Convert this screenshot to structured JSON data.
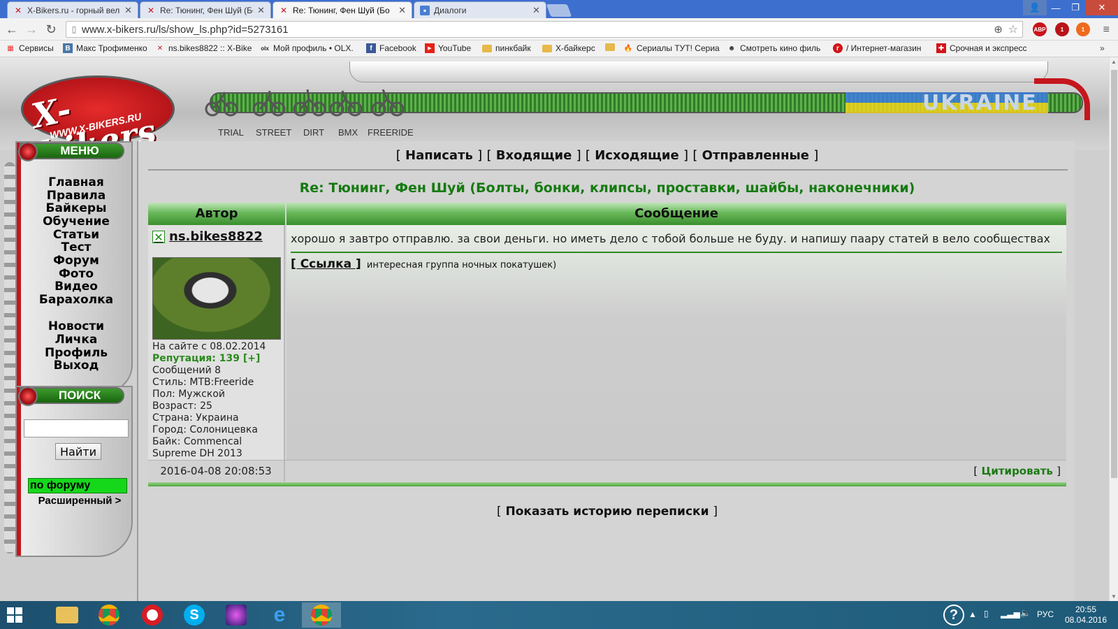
{
  "browser": {
    "tabs": [
      {
        "title": "X-Bikers.ru - горный вело",
        "favicon": "x-bikers-icon"
      },
      {
        "title": "Re: Тюнинг, Фен Шуй (Бо",
        "favicon": "x-bikers-icon"
      },
      {
        "title": "Re: Тюнинг, Фен Шуй (Бо",
        "favicon": "x-bikers-icon",
        "active": true
      },
      {
        "title": "Диалоги",
        "favicon": "dialogs-icon"
      }
    ],
    "url": "www.x-bikers.ru/ls/show_ls.php?id=5273161",
    "extensions": [
      "ABP",
      "1",
      "1"
    ],
    "bookmarks": [
      "Сервисы",
      "Макс Трофименко",
      "ns.bikes8822 :: X-Bike",
      "Мой профиль • OLX.",
      "Facebook",
      "YouTube",
      "пинкбайк",
      "Х-байкерс",
      "",
      "Сериалы ТУТ! Сериа",
      "Смотреть кино филь",
      "/ Интернет-магазин",
      "Срочная и экспресс"
    ]
  },
  "site": {
    "logo_text": "X-bikers",
    "logo_url": "WWW.X-BIKERS.RU",
    "banner_label": "UKRAINE",
    "categories": [
      "TRIAL",
      "STREET",
      "DIRT",
      "BMX",
      "FREERIDE"
    ]
  },
  "sidebar": {
    "menu_title": "МЕНЮ",
    "menu_items": [
      "Главная",
      "Правила",
      "Байкеры",
      "Обучение",
      "Статьи",
      "Тест",
      "Форум",
      "Фото",
      "Видео",
      "Барахолка"
    ],
    "menu_items2": [
      "Новости",
      "Личка",
      "Профиль",
      "Выход"
    ],
    "search_title": "ПОИСК",
    "search_value": "",
    "search_button": "Найти",
    "search_scope": "по форуму",
    "advanced": "Расширенный >"
  },
  "content": {
    "nav": {
      "write": "Написать",
      "inbox": "Входящие",
      "outbox": "Исходящие",
      "sent": "Отправленные",
      "bracket_open": "[",
      "bracket_close": "]"
    },
    "title": "Re: Тюнинг, Фен Шуй (Болты, бонки, клипсы, проставки, шайбы, наконечники)",
    "table": {
      "col_author": "Автор",
      "col_message": "Сообщение"
    },
    "author": {
      "name": "ns.bikes8822",
      "since": "На сайте с 08.02.2014",
      "reputation": "Репутация: 139 [+]",
      "posts": "Сообщений 8",
      "style": "Стиль: MTB:Freeride",
      "gender": "Пол: Мужской",
      "age": "Возраст: 25",
      "country": "Страна: Украина",
      "city": "Город: Солоницевка",
      "bike1": "Байк: Commencal",
      "bike2": "Supreme DH 2013"
    },
    "message": {
      "text": "хорошо я завтро отправлю. за свои деньги. но иметь дело с тобой больше не буду. и напишу паару статей в вело сообществах",
      "sig_link": "[ Ссылка ]",
      "sig_text": "интересная группа ночных покатушек)"
    },
    "date": "2016-04-08 20:08:53",
    "quote": "Цитировать",
    "history": "Показать историю переписки"
  },
  "taskbar": {
    "lang": "РУС",
    "time": "20:55",
    "date": "08.04.2016"
  },
  "colors": {
    "title_green": "#157a10",
    "header_green": "#4ea73e",
    "brand_red": "#c5161d",
    "search_scope_bg": "#16d81b"
  }
}
